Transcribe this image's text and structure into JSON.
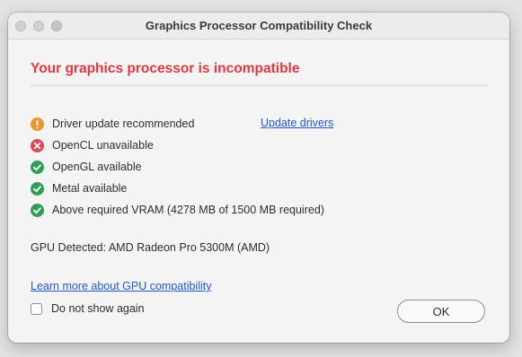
{
  "window": {
    "title": "Graphics Processor Compatibility Check",
    "traffic_lights": [
      "close",
      "minimize",
      "zoom"
    ]
  },
  "headline": {
    "text": "Your graphics processor is incompatible",
    "color": "#e0383e"
  },
  "checks": [
    {
      "status": "warning",
      "icon": "warning-icon",
      "color": "#e8962f",
      "label": "Driver update recommended",
      "link": "Update drivers"
    },
    {
      "status": "error",
      "icon": "error-icon",
      "color": "#dc4a55",
      "label": "OpenCL unavailable"
    },
    {
      "status": "ok",
      "icon": "checkmark-icon",
      "color": "#2f9f55",
      "label": "OpenGL available"
    },
    {
      "status": "ok",
      "icon": "checkmark-icon",
      "color": "#2f9f55",
      "label": "Metal available"
    },
    {
      "status": "ok",
      "icon": "checkmark-icon",
      "color": "#2f9f55",
      "label": "Above required VRAM (4278 MB of 1500 MB required)"
    }
  ],
  "gpu_detected": "GPU Detected: AMD Radeon Pro 5300M (AMD)",
  "learn_more_link": "Learn more about GPU compatibility",
  "do_not_show": {
    "label": "Do not show again",
    "checked": false
  },
  "ok_button": "OK",
  "colors": {
    "link": "#2158c9",
    "background": "#f4f4f5"
  }
}
